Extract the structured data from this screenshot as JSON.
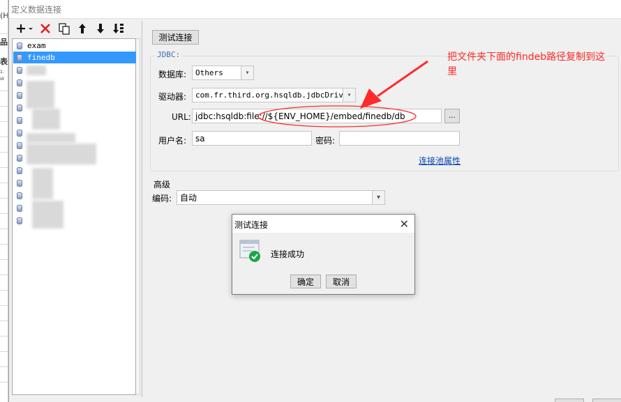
{
  "background": {
    "strip_texts": [
      "(H",
      "品",
      "表",
      "1.",
      "id"
    ]
  },
  "window": {
    "title": "定义数据连接"
  },
  "toolbar": {
    "add_icon": "plus-dropdown-icon",
    "delete_icon": "red-x-icon",
    "copy_icon": "copy-icon",
    "up_icon": "arrow-up-icon",
    "down_icon": "arrow-down-icon",
    "sort_icon": "sort-icon"
  },
  "connections": {
    "items": [
      {
        "label": "exam",
        "selected": false
      },
      {
        "label": "finedb",
        "selected": true
      }
    ]
  },
  "panel": {
    "test_button": "测试连接",
    "jdbc_label": "JDBC:",
    "db_label": "数据库:",
    "db_value": "Others",
    "driver_label": "驱动器:",
    "driver_value": "com.fr.third.org.hsqldb.jdbcDriver",
    "url_label": "URL:",
    "url_value": "jdbc:hsqldb:file://${ENV_HOME}/embed/finedb/db",
    "browse_button": "...",
    "user_label": "用户名:",
    "user_value": "sa",
    "password_label": "密码:",
    "password_value": "",
    "pool_link": "连接池属性",
    "advanced_label": "高级",
    "encoding_label": "编码:",
    "encoding_value": "自动"
  },
  "annotation": {
    "text": "把文件夹下面的findeb路径复制到这里",
    "color": "#ff2a2a"
  },
  "dialog": {
    "title": "测试连接",
    "message": "连接成功",
    "ok_button": "确定",
    "cancel_button": "取消",
    "icon": "success-check-icon"
  },
  "colors": {
    "selection": "#3399ff",
    "link": "#0645ad",
    "annotation_red": "#ff2a2a",
    "success_green": "#1fa34a"
  }
}
